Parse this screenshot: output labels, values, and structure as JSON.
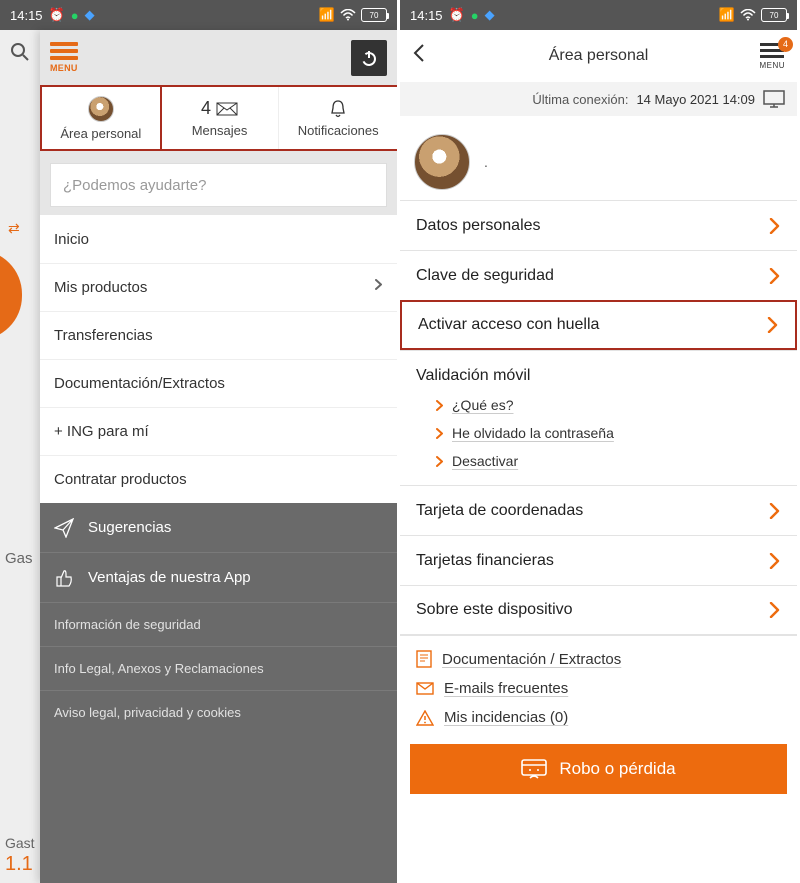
{
  "status": {
    "time": "14:15",
    "battery": "70"
  },
  "left": {
    "menu_label": "MENU",
    "tabs": {
      "area": "Área personal",
      "messages_count": "4",
      "messages": "Mensajes",
      "notifications": "Notificaciones"
    },
    "search_placeholder": "¿Podemos ayudarte?",
    "items": [
      "Inicio",
      "Mis productos",
      "Transferencias",
      "Documentación/Extractos",
      "+ ING para mí",
      "Contratar productos"
    ],
    "dark": {
      "sugerencias": "Sugerencias",
      "ventajas": "Ventajas de nuestra App",
      "info_seg": "Información de seguridad",
      "legal": "Info Legal, Anexos y Reclamaciones",
      "aviso": "Aviso legal, privacidad y cookies"
    },
    "bg": {
      "gastos1": "Gas",
      "gastos2": "Gast",
      "num": "1.1"
    }
  },
  "right": {
    "title": "Área personal",
    "menu_label": "MENU",
    "badge": "4",
    "last_label": "Última conexión:",
    "last_value": "14 Mayo 2021 14:09",
    "name": ".",
    "rows": {
      "datos": "Datos personales",
      "clave": "Clave de seguridad",
      "huella": "Activar acceso con huella",
      "valid": "Validación móvil",
      "sub_que": "¿Qué es?",
      "sub_olv": "He olvidado la contraseña",
      "sub_des": "Desactivar",
      "coord": "Tarjeta de coordenadas",
      "fin": "Tarjetas financieras",
      "disp": "Sobre este dispositivo"
    },
    "links": {
      "doc": "Documentación / Extractos",
      "email": "E-mails frecuentes",
      "inc": "Mis incidencias (0)"
    },
    "cta": "Robo o pérdida"
  }
}
